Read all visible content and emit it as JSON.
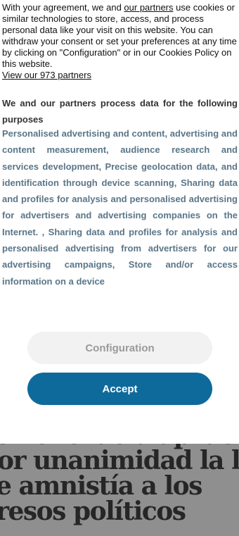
{
  "consent": {
    "intro_before_link": "With your agreement, we and ",
    "intro_link": "our partners",
    "intro_after_link": " use cookies or similar technologies to store, access, and process personal data like your visit on this website. You can withdraw your consent or set your preferences at any time by clicking on \"Configuration\" or in our Cookies Policy on this website.",
    "partners_link": "View our 973 partners",
    "purposes_heading": "We and our partners process data for the following purposes",
    "purposes_text": "Personalised advertising and content, advertising and content measurement, audience research and services development, Precise geolocation data, and identification through device scanning, Sharing data and profiles for analysis and personalised advertising for advertisers and advertising companies on the Internet. , Sharing data and profiles for analysis and personalised advertising from advertisers for our advertising campaigns, Store and/or access information on a device",
    "configuration_label": "Configuration",
    "accept_label": "Accept"
  },
  "article": {
    "headline_lines": [
      "e Venezuela aprueba",
      "or unanimidad la ley",
      "e amnistía a los",
      "resos políticos"
    ]
  },
  "colors": {
    "accent": "#0f6a9c",
    "purposes_text": "#5a7689",
    "secondary_button": "#f2f2f2"
  }
}
